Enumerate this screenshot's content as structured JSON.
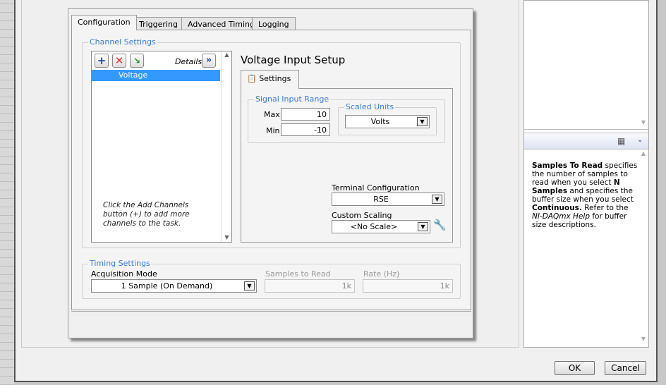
{
  "tabs": [
    "Configuration",
    "Triggering",
    "Advanced Timing",
    "Logging"
  ],
  "channel_settings": {
    "title": "Channel Settings",
    "details_label": "Details",
    "channels": [
      "Voltage"
    ],
    "hint": "Click the Add Channels button (+) to add more channels to the task.",
    "icons": [
      "add-icon",
      "remove-icon",
      "change-icon",
      "expand-details-icon"
    ]
  },
  "voltage_setup": {
    "title": "Voltage Input Setup",
    "settings_tab": "Settings",
    "signal_range_title": "Signal Input Range",
    "max_label": "Max",
    "max_value": "10",
    "min_label": "Min",
    "min_value": "-10",
    "scaled_units_title": "Scaled Units",
    "scaled_units_value": "Volts",
    "terminal_config_label": "Terminal Configuration",
    "terminal_config_value": "RSE",
    "custom_scaling_label": "Custom Scaling",
    "custom_scaling_value": "<No Scale>"
  },
  "timing": {
    "title": "Timing Settings",
    "acq_mode_label": "Acquisition Mode",
    "acq_mode_value": "1 Sample (On Demand)",
    "samples_label": "Samples to Read",
    "samples_value": "1k",
    "rate_label": "Rate (Hz)",
    "rate_value": "1k"
  },
  "help": {
    "title": "Samples To Read",
    "t1": " specifies the number of samples to read when you select ",
    "b1": "N Samples",
    "t2": " and specifies the buffer size when you select ",
    "b2": "Continuous.",
    "t3": " Refer to the ",
    "i1": "NI-DAQmx Help",
    "t4": " for buffer size descriptions."
  },
  "buttons": {
    "ok": "OK",
    "cancel": "Cancel"
  },
  "accent": "#3a7bd5",
  "selection": "#3399ff"
}
